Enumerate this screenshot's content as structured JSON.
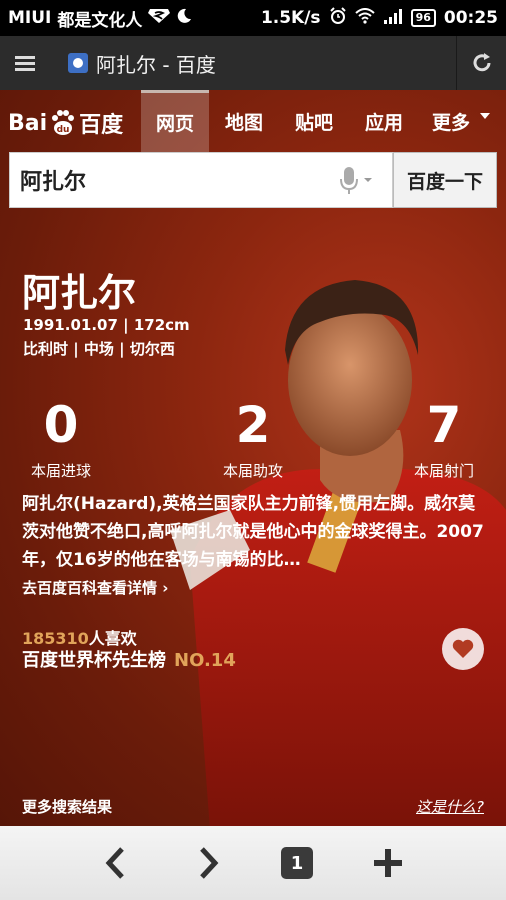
{
  "status_bar": {
    "brand": "MIUI",
    "carrier": "都是文化人",
    "speed": "1.5K/s",
    "battery": "96",
    "time": "00:25"
  },
  "browser": {
    "title": "阿扎尔 - 百度",
    "tab_count": "1"
  },
  "baidu": {
    "logo_text_left": "Bai",
    "logo_text_right": "百度",
    "tabs": [
      "网页",
      "地图",
      "贴吧",
      "应用",
      "更多"
    ],
    "active_tab": "网页",
    "search_value": "阿扎尔",
    "search_button": "百度一下"
  },
  "player": {
    "name": "阿扎尔",
    "meta_line1": "1991.01.07 | 172cm",
    "meta_line2": "比利时 | 中场 | 切尔西",
    "stats": [
      {
        "value": "0",
        "label": "本届进球"
      },
      {
        "value": "2",
        "label": "本届助攻"
      },
      {
        "value": "7",
        "label": "本届射门"
      }
    ],
    "description": "阿扎尔(Hazard),英格兰国家队主力前锋,惯用左脚。威尔莫茨对他赞不绝口,高呼阿扎尔就是他心中的金球奖得主。2007年，仅16岁的他在客场与南锡的比…",
    "baike_link": "去百度百科查看详情 ›",
    "likes_count": "185310",
    "likes_unit": "人喜欢",
    "rank_label": "百度世界杯先生榜",
    "rank_value": "NO.14"
  },
  "footer": {
    "more_results": "更多搜索结果",
    "what_is_this": "这是什么?"
  },
  "colors": {
    "accent_gold": "#e1a45a",
    "background_red": "#8c260f"
  }
}
